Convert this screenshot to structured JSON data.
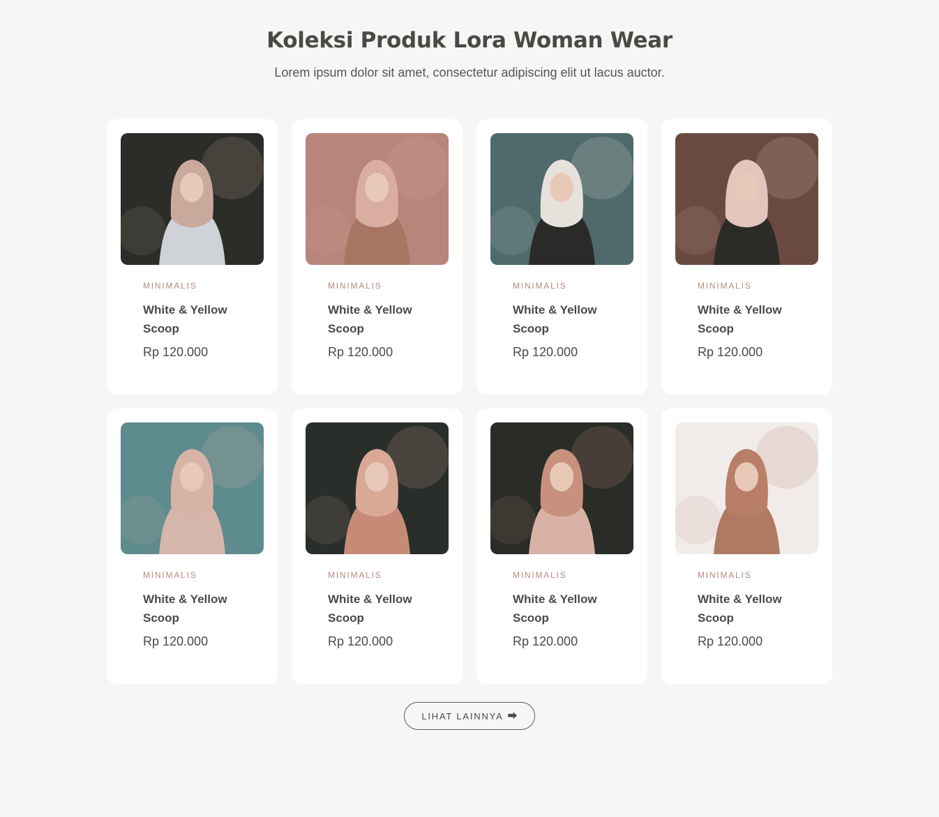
{
  "header": {
    "title": "Koleksi Produk Lora Woman Wear",
    "subtitle": "Lorem ipsum dolor sit amet, consectetur adipiscing elit ut lacus auctor."
  },
  "products": [
    {
      "category": "MINIMALIS",
      "name": "White & Yellow Scoop",
      "price": "Rp 120.000",
      "photo": {
        "bg": "#2b2d28",
        "accent": "#c9a99c",
        "garment": "#cfd2d6"
      }
    },
    {
      "category": "MINIMALIS",
      "name": "White & Yellow Scoop",
      "price": "Rp 120.000",
      "photo": {
        "bg": "#b8857a",
        "accent": "#d9ad9f",
        "garment": "#a77562"
      }
    },
    {
      "category": "MINIMALIS",
      "name": "White & Yellow Scoop",
      "price": "Rp 120.000",
      "photo": {
        "bg": "#4f6a6a",
        "accent": "#e7e1dc",
        "garment": "#2a2a28"
      }
    },
    {
      "category": "MINIMALIS",
      "name": "White & Yellow Scoop",
      "price": "Rp 120.000",
      "photo": {
        "bg": "#6a4a40",
        "accent": "#e2c6bb",
        "garment": "#2b2c28"
      }
    },
    {
      "category": "MINIMALIS",
      "name": "White & Yellow Scoop",
      "price": "Rp 120.000",
      "photo": {
        "bg": "#5e8b8e",
        "accent": "#d7b3a7",
        "garment": "#d5b6aa"
      }
    },
    {
      "category": "MINIMALIS",
      "name": "White & Yellow Scoop",
      "price": "Rp 120.000",
      "photo": {
        "bg": "#2a2e2b",
        "accent": "#d9a996",
        "garment": "#c58b77"
      }
    },
    {
      "category": "MINIMALIS",
      "name": "White & Yellow Scoop",
      "price": "Rp 120.000",
      "photo": {
        "bg": "#2a2c28",
        "accent": "#c7917d",
        "garment": "#d8b2a5"
      }
    },
    {
      "category": "MINIMALIS",
      "name": "White & Yellow Scoop",
      "price": "Rp 120.000",
      "photo": {
        "bg": "#f1ecea",
        "accent": "#b97e67",
        "garment": "#b07a62"
      }
    }
  ],
  "more_button": {
    "label": "LIHAT LAINNYA",
    "icon": "arrow-right-icon"
  },
  "colors": {
    "page_bg": "#f6f6f6",
    "card_bg": "#ffffff",
    "category_text": "#b28a80",
    "heading_text": "#4a4a44"
  }
}
